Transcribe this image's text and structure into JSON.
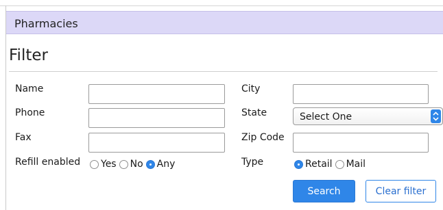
{
  "panel": {
    "title": "Pharmacies"
  },
  "filter": {
    "heading": "Filter",
    "fields": {
      "name": {
        "label": "Name",
        "value": ""
      },
      "phone": {
        "label": "Phone",
        "value": ""
      },
      "fax": {
        "label": "Fax",
        "value": ""
      },
      "city": {
        "label": "City",
        "value": ""
      },
      "state": {
        "label": "State",
        "selected": "Select One"
      },
      "zip": {
        "label": "Zip Code",
        "value": ""
      }
    },
    "refill": {
      "label": "Refill enabled",
      "options": [
        "Yes",
        "No",
        "Any"
      ],
      "selected": "Any"
    },
    "type": {
      "label": "Type",
      "options": [
        "Retail",
        "Mail"
      ],
      "selected": "Retail"
    },
    "buttons": {
      "search": "Search",
      "clear": "Clear filter"
    }
  },
  "colors": {
    "header_bg": "#dcd8f7",
    "accent": "#2f86e8"
  }
}
